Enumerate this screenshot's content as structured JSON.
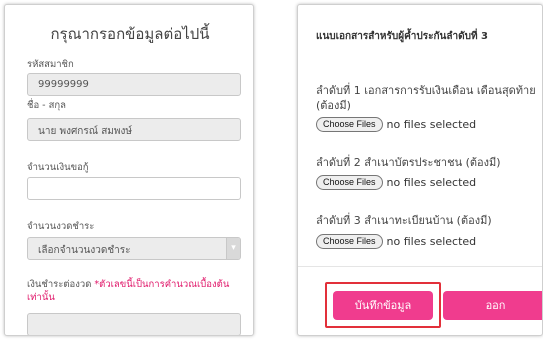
{
  "left_form": {
    "title": "กรุณากรอกข้อมูลต่อไปนี้",
    "member_id": {
      "label": "รหัสสมาชิก",
      "value": "99999999"
    },
    "full_name": {
      "label": "ชื่อ - สกุล",
      "value": "นาย พงศกรณ์ สมพงษ์"
    },
    "loan_amount": {
      "label": "จำนวนเงินขอกู้",
      "value": ""
    },
    "installments": {
      "label": "จำนวนงวดชำระ",
      "selected": "เลือกจำนวนงวดชำระ"
    },
    "payment_per_installment": {
      "label": "เงินชำระต่องวด",
      "note": "*ตัวเลขนี้เป็นการคำนวณเบื้องต้นเท่านั้น",
      "value": ""
    }
  },
  "right_form": {
    "section_title": "แนบเอกสารสำหรับผู้ค้ำประกันลำดับที่ 3",
    "file_button_label": "Choose Files",
    "no_file_text": "no files selected",
    "documents": [
      {
        "label_line1": "ลำดับที่ 1 เอกสารการรับเงินเดือน เดือนสุดท้าย",
        "label_line2": "(ต้องมี)"
      },
      {
        "label_line1": "ลำดับที่ 2 สำเนาบัตรประชาชน (ต้องมี)"
      },
      {
        "label_line1": "ลำดับที่ 3 สำเนาทะเบียนบ้าน (ต้องมี)"
      }
    ],
    "save_label": "บันทึกข้อมูล",
    "exit_label": "ออก"
  },
  "colors": {
    "accent_pink": "#f03c8e",
    "highlight_red": "#e2303a",
    "note_red": "#e0186a"
  },
  "icons": {
    "select_arrow": "chevron-down-icon"
  }
}
